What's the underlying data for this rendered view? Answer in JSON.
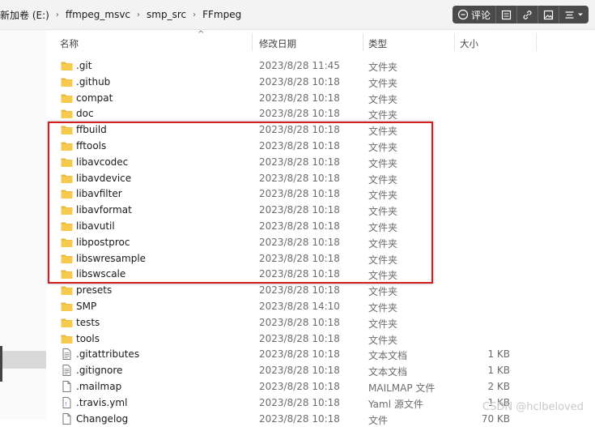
{
  "breadcrumb": [
    "新加卷 (E:)",
    "ffmpeg_msvc",
    "smp_src",
    "FFmpeg"
  ],
  "toolbar": {
    "comment_label": "评论"
  },
  "columns": {
    "name": "名称",
    "date": "修改日期",
    "type": "类型",
    "size": "大小"
  },
  "files": [
    {
      "name": ".git",
      "date": "2023/8/28 11:45",
      "type": "文件夹",
      "size": "",
      "icon": "folder-icon"
    },
    {
      "name": ".github",
      "date": "2023/8/28 10:18",
      "type": "文件夹",
      "size": "",
      "icon": "folder-icon"
    },
    {
      "name": "compat",
      "date": "2023/8/28 10:18",
      "type": "文件夹",
      "size": "",
      "icon": "folder-icon"
    },
    {
      "name": "doc",
      "date": "2023/8/28 10:18",
      "type": "文件夹",
      "size": "",
      "icon": "folder-icon"
    },
    {
      "name": "ffbuild",
      "date": "2023/8/28 10:18",
      "type": "文件夹",
      "size": "",
      "icon": "folder-icon"
    },
    {
      "name": "fftools",
      "date": "2023/8/28 10:18",
      "type": "文件夹",
      "size": "",
      "icon": "folder-icon"
    },
    {
      "name": "libavcodec",
      "date": "2023/8/28 10:18",
      "type": "文件夹",
      "size": "",
      "icon": "folder-icon"
    },
    {
      "name": "libavdevice",
      "date": "2023/8/28 10:18",
      "type": "文件夹",
      "size": "",
      "icon": "folder-icon"
    },
    {
      "name": "libavfilter",
      "date": "2023/8/28 10:18",
      "type": "文件夹",
      "size": "",
      "icon": "folder-icon"
    },
    {
      "name": "libavformat",
      "date": "2023/8/28 10:18",
      "type": "文件夹",
      "size": "",
      "icon": "folder-icon"
    },
    {
      "name": "libavutil",
      "date": "2023/8/28 10:18",
      "type": "文件夹",
      "size": "",
      "icon": "folder-icon"
    },
    {
      "name": "libpostproc",
      "date": "2023/8/28 10:18",
      "type": "文件夹",
      "size": "",
      "icon": "folder-icon"
    },
    {
      "name": "libswresample",
      "date": "2023/8/28 10:18",
      "type": "文件夹",
      "size": "",
      "icon": "folder-icon"
    },
    {
      "name": "libswscale",
      "date": "2023/8/28 10:18",
      "type": "文件夹",
      "size": "",
      "icon": "folder-icon"
    },
    {
      "name": "presets",
      "date": "2023/8/28 10:18",
      "type": "文件夹",
      "size": "",
      "icon": "folder-icon"
    },
    {
      "name": "SMP",
      "date": "2023/8/28 14:10",
      "type": "文件夹",
      "size": "",
      "icon": "folder-icon"
    },
    {
      "name": "tests",
      "date": "2023/8/28 10:18",
      "type": "文件夹",
      "size": "",
      "icon": "folder-icon"
    },
    {
      "name": "tools",
      "date": "2023/8/28 10:18",
      "type": "文件夹",
      "size": "",
      "icon": "folder-icon"
    },
    {
      "name": ".gitattributes",
      "date": "2023/8/28 10:18",
      "type": "文本文档",
      "size": "1 KB",
      "icon": "text-file-icon"
    },
    {
      "name": ".gitignore",
      "date": "2023/8/28 10:18",
      "type": "文本文档",
      "size": "1 KB",
      "icon": "text-file-icon"
    },
    {
      "name": ".mailmap",
      "date": "2023/8/28 10:18",
      "type": "MAILMAP 文件",
      "size": "2 KB",
      "icon": "file-icon"
    },
    {
      "name": ".travis.yml",
      "date": "2023/8/28 10:18",
      "type": "Yaml 源文件",
      "size": "1 KB",
      "icon": "yaml-file-icon"
    },
    {
      "name": "Changelog",
      "date": "2023/8/28 10:18",
      "type": "文件",
      "size": "70 KB",
      "icon": "file-icon"
    }
  ],
  "watermark": "CSDN @hclbeloved",
  "colors": {
    "highlight_border": "#d21f1f",
    "folder": "#f2c14e",
    "toolbar_bg": "#4a4a4a"
  }
}
